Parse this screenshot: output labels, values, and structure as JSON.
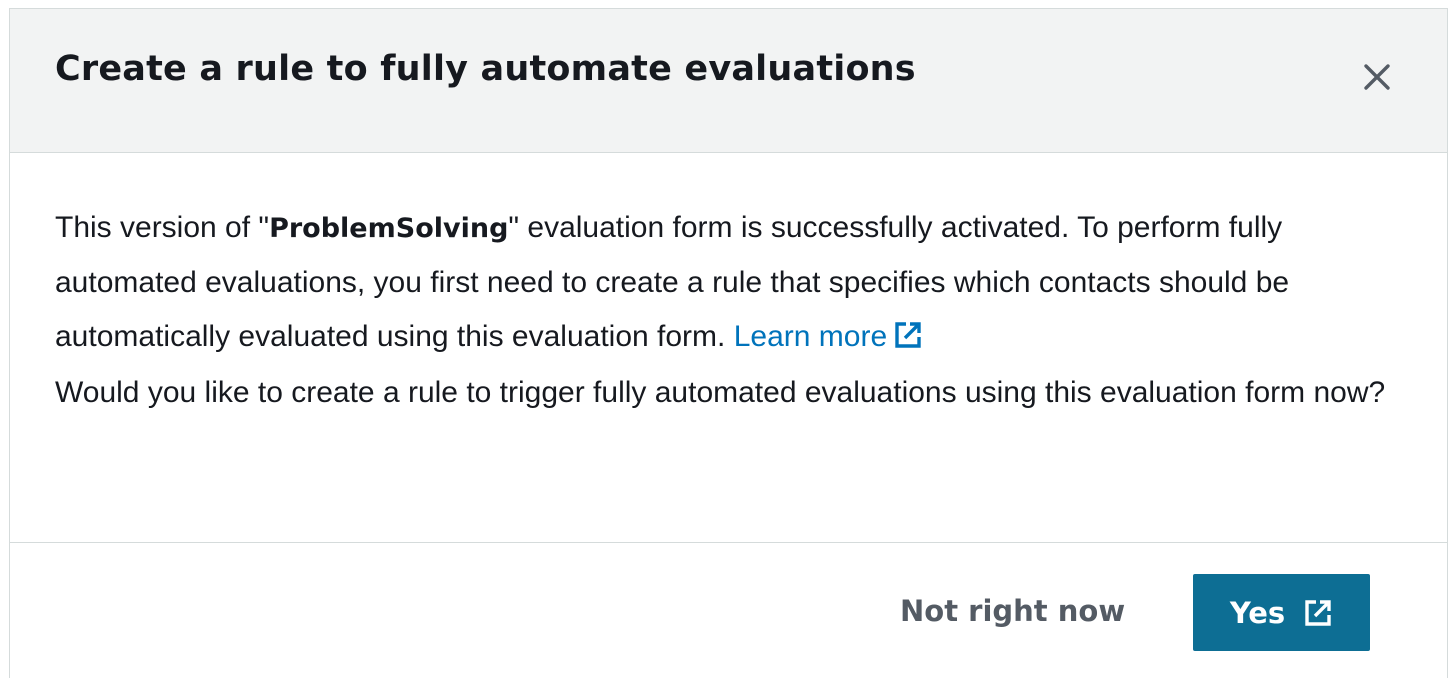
{
  "modal": {
    "title": "Create a rule to fully automate evaluations",
    "close_icon": "close-icon",
    "body": {
      "paragraph1_prefix": "This version of \"",
      "form_name": "ProblemSolving",
      "paragraph1_middle": "\" evaluation form is successfully activated. To perform fully automated evaluations, you first need to create a rule that specifies which contacts should be automatically evaluated using this evaluation form.",
      "learn_more_label": "Learn more",
      "learn_more_icon": "external-link-icon",
      "paragraph2": "Would you like to create a rule to trigger fully automated evaluations using this evaluation form now?"
    },
    "footer": {
      "not_now_label": "Not right now",
      "yes_label": "Yes",
      "yes_icon": "external-link-icon"
    }
  },
  "colors": {
    "header_bg": "#f2f3f3",
    "border": "#d5dbdb",
    "link": "#0073bb",
    "primary_button": "#0d6e94",
    "secondary_text": "#545b64"
  }
}
